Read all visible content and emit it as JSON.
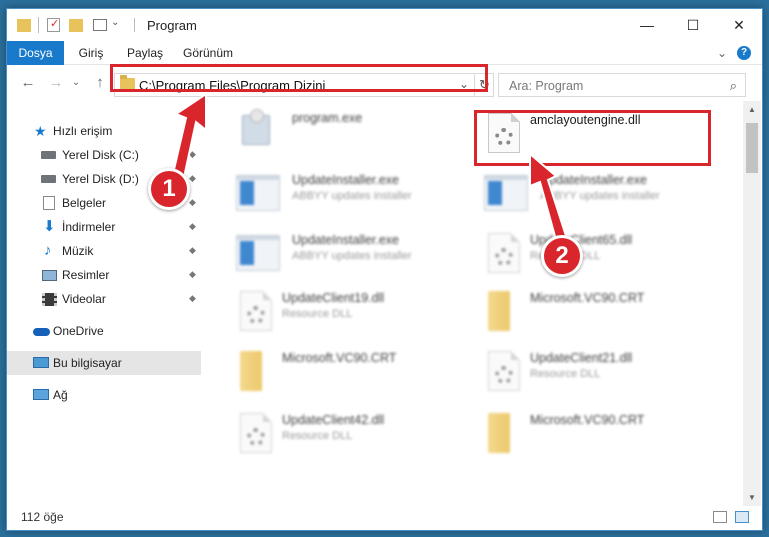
{
  "window": {
    "title": "Program",
    "minimize_glyph": "—",
    "maximize_glyph": "☐",
    "close_glyph": "✕"
  },
  "ribbon": {
    "tabs": [
      "Dosya",
      "Giriş",
      "Paylaş",
      "Görünüm"
    ],
    "expand_glyph": "⌄",
    "help_glyph": "?"
  },
  "nav": {
    "back_glyph": "←",
    "forward_glyph": "→",
    "recent_glyph": "⌄",
    "up_glyph": "↑",
    "address": "C:\\Program Files\\Program Dizini",
    "address_chevron": "⌄",
    "refresh_glyph": "↻",
    "search_placeholder": "Ara: Program",
    "search_glyph": "⌕"
  },
  "sidebar": {
    "items": [
      {
        "label": "Hızlı erişim",
        "icon": "star-icon"
      },
      {
        "label": "Yerel Disk (C:)",
        "icon": "drive-icon",
        "pinned": true
      },
      {
        "label": "Yerel Disk (D:)",
        "icon": "drive-icon",
        "pinned": true
      },
      {
        "label": "Belgeler",
        "icon": "documents-icon",
        "pinned": true
      },
      {
        "label": "İndirmeler",
        "icon": "download-icon",
        "pinned": true
      },
      {
        "label": "Müzik",
        "icon": "music-icon",
        "pinned": true
      },
      {
        "label": "Resimler",
        "icon": "pictures-icon",
        "pinned": true
      },
      {
        "label": "Videolar",
        "icon": "videos-icon",
        "pinned": true
      },
      {
        "label": "OneDrive",
        "icon": "cloud-icon"
      },
      {
        "label": "Bu bilgisayar",
        "icon": "computer-icon",
        "selected": true
      },
      {
        "label": "Ağ",
        "icon": "network-icon"
      }
    ],
    "pin_glyph": "📌"
  },
  "files": [
    {
      "name": "program.exe",
      "desc": "",
      "kind": "exe-setup"
    },
    {
      "name": "amclayoutengine.dll",
      "desc": "",
      "kind": "dll"
    },
    {
      "name": "UpdateInstaller.exe",
      "desc": "ABBYY updates installer",
      "kind": "exe"
    },
    {
      "name": "UpdateInstaller.exe",
      "desc": "ABBYY updates installer",
      "kind": "exe"
    },
    {
      "name": "UpdateInstaller.exe",
      "desc": "ABBYY updates installer",
      "kind": "exe"
    },
    {
      "name": "UpdateClient65.dll",
      "desc": "Resource DLL",
      "kind": "dll"
    },
    {
      "name": "UpdateClient19.dll",
      "desc": "Resource DLL",
      "kind": "dll"
    },
    {
      "name": "Microsoft.VC90.CRT",
      "desc": "",
      "kind": "folder"
    },
    {
      "name": "Microsoft.VC90.CRT",
      "desc": "",
      "kind": "folder"
    },
    {
      "name": "UpdateClient21.dll",
      "desc": "Resource DLL",
      "kind": "dll"
    },
    {
      "name": "UpdateClient42.dll",
      "desc": "Resource DLL",
      "kind": "dll"
    },
    {
      "name": "Microsoft.VC90.CRT",
      "desc": "",
      "kind": "folder"
    }
  ],
  "status": {
    "count": "112 öğe"
  },
  "annotations": {
    "step1": "1",
    "step2": "2"
  },
  "colors": {
    "accent": "#1979ca",
    "highlight": "#d9262c",
    "folder": "#e9bf52"
  }
}
